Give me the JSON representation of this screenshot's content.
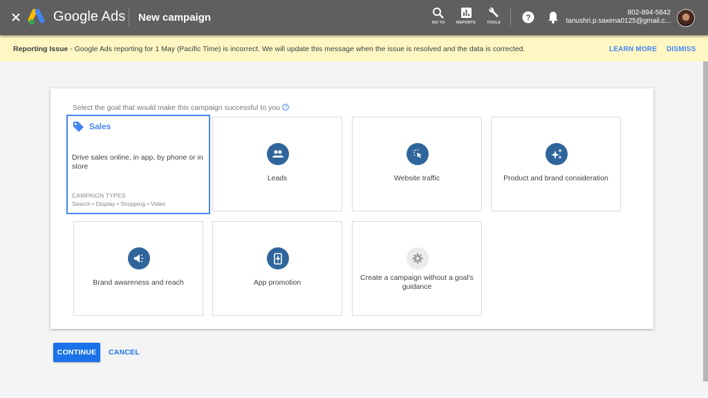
{
  "header": {
    "close_icon": "close-icon",
    "brand": "Google Ads",
    "page_title": "New campaign",
    "tools": [
      {
        "icon": "search-icon",
        "label": "GO TO"
      },
      {
        "icon": "reports-icon",
        "label": "REPORTS"
      },
      {
        "icon": "wrench-icon",
        "label": "TOOLS"
      }
    ],
    "help_icon": "help-icon",
    "notifications_icon": "bell-icon",
    "account": {
      "phone": "802-894-5842",
      "email": "tanushri.p.saxena0125@gmail.c..."
    },
    "colors": {
      "bar": "#5f5f5f",
      "text": "#ffffff"
    }
  },
  "notice": {
    "title": "Reporting Issue",
    "message": " - Google Ads reporting for 1 May (Pacific Time) is incorrect. We will update this message when the issue is resolved and the data is corrected.",
    "learn_more": "LEARN MORE",
    "dismiss": "DISMISS",
    "background": "#fef7c3"
  },
  "goal_selection": {
    "prompt": "Select the goal that would make this campaign successful to you",
    "selected": "Sales",
    "goals": [
      {
        "name": "Sales",
        "icon": "tag-icon",
        "description": "Drive sales online, in app, by phone or in store",
        "campaign_types_title": "CAMPAIGN TYPES",
        "campaign_types": "Search • Display • Shopping • Video",
        "selected": true
      },
      {
        "name": "Leads",
        "icon": "people-icon"
      },
      {
        "name": "Website traffic",
        "icon": "cursor-click-icon"
      },
      {
        "name": "Product and brand consideration",
        "icon": "sparkle-icon"
      },
      {
        "name": "Brand awareness and reach",
        "icon": "megaphone-icon"
      },
      {
        "name": "App promotion",
        "icon": "phone-download-icon"
      },
      {
        "name": "Create a campaign without a goal's guidance",
        "icon": "gear-icon"
      }
    ],
    "accent": "#4285f4",
    "icon_circle": "#2f659b"
  },
  "actions": {
    "continue": "CONTINUE",
    "cancel": "CANCEL",
    "primary_color": "#1a73e8"
  }
}
